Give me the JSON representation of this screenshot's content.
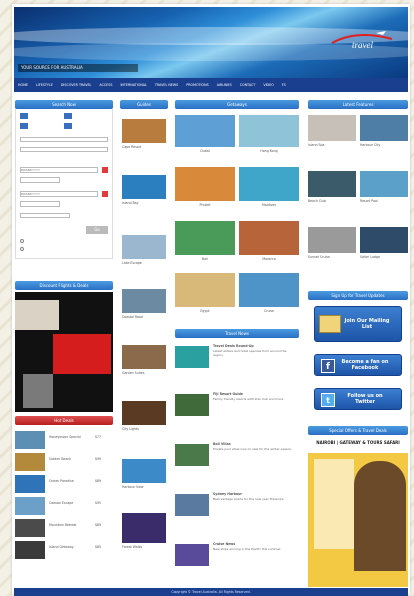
{
  "banner": {
    "tagline": "YOUR SOURCE FOR AUSTRALIA",
    "brand": "travel"
  },
  "nav": [
    "HOME",
    "LIFESTYLE",
    "DISCOVER TRAVEL",
    "ACCESS",
    "INTERNATIONAL",
    "TRAVEL NEWS",
    "PROMOTIONS",
    "AIRLINES",
    "CONTACT",
    "VIDEO",
    "FS"
  ],
  "search": {
    "title": "Search Now",
    "date_placeholder": "DD/MM/YYYY",
    "button": "Go"
  },
  "airfares": {
    "title": "Discount Flights & Deals"
  },
  "deals": {
    "title": "Hot Deals",
    "rows": [
      {
        "text": "Honeymoon Special",
        "price": "$77"
      },
      {
        "text": "Golden Beach",
        "price": "$99"
      },
      {
        "text": "Ocean Paradise",
        "price": "$89"
      },
      {
        "text": "Coastal Escape",
        "price": "$95"
      },
      {
        "text": "Mountain Retreat",
        "price": "$69"
      },
      {
        "text": "Island Getaway",
        "price": "$85"
      }
    ]
  },
  "col2": {
    "title": "Guides",
    "items": [
      "Cape Resort",
      "Island Bay",
      "Lake Escape",
      "Coastal Road",
      "Garden Suites",
      "City Lights",
      "Harbour View",
      "Forest Walks"
    ]
  },
  "getaways": {
    "title": "Getaways",
    "items": [
      "Dubai",
      "Hong Kong",
      "Phuket",
      "Maldives",
      "Bali",
      "Morocco",
      "Egypt",
      "Cruise"
    ]
  },
  "news": {
    "title": "Travel News",
    "items": [
      {
        "title": "Travel Deals Round-Up",
        "text": "Latest airfare and hotel specials from around the region."
      },
      {
        "title": "Fiji Resort Guide",
        "text": "Family friendly resorts with kids club and more."
      },
      {
        "title": "Bali Villas",
        "text": "Private pool villas now on sale for the winter season."
      },
      {
        "title": "Sydney Harbour",
        "text": "Best vantage points for the new year fireworks."
      },
      {
        "title": "Cruise News",
        "text": "New ships arriving in the Pacific this summer."
      }
    ]
  },
  "featured": {
    "title": "Latest Features",
    "items": [
      "Island Spa",
      "Harbour City",
      "Beach Club",
      "Resort Pool",
      "Sunset Cruise",
      "Safari Lodge"
    ]
  },
  "social": {
    "title": "Sign Up for Travel Updates",
    "mailing": "Join Our Mailing List",
    "facebook": "Become a fan on Facebook",
    "twitter": "Follow us on Twitter"
  },
  "ad": {
    "title": "Special Offers & Travel Deals",
    "headline": "NAIROBI | GATEWAY & TOURS SAFARI"
  },
  "footer": "Copyright © Travel Australia. All Rights Reserved."
}
